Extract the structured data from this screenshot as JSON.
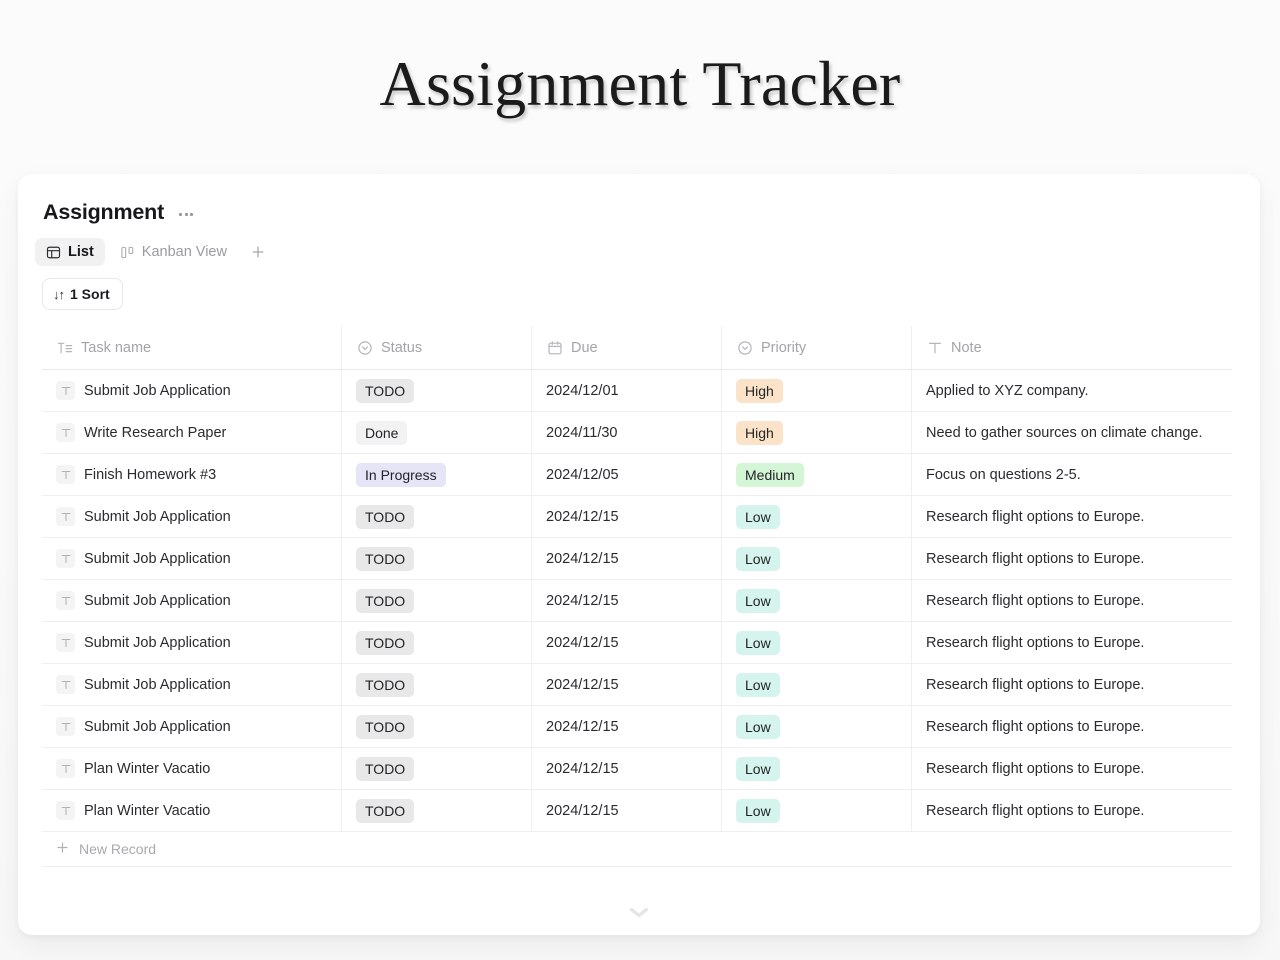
{
  "page": {
    "title": "Assignment Tracker"
  },
  "database": {
    "name": "Assignment",
    "more_menu_label": "···"
  },
  "views": {
    "tabs": [
      {
        "label": "List",
        "icon": "layout-list-icon",
        "active": true
      },
      {
        "label": "Kanban View",
        "icon": "kanban-columns-icon",
        "active": false
      }
    ],
    "add_view_label": "+"
  },
  "toolbar": {
    "sort": {
      "label": "1 Sort",
      "icon": "sort-arrows-icon",
      "glyph": "↓↑"
    }
  },
  "table": {
    "columns": [
      {
        "key": "task",
        "label": "Task name",
        "icon": "text-lines-icon"
      },
      {
        "key": "status",
        "label": "Status",
        "icon": "select-circle-icon"
      },
      {
        "key": "due",
        "label": "Due",
        "icon": "calendar-icon"
      },
      {
        "key": "priority",
        "label": "Priority",
        "icon": "select-circle-icon"
      },
      {
        "key": "note",
        "label": "Note",
        "icon": "text-t-icon"
      }
    ],
    "rows": [
      {
        "task": "Submit Job Application",
        "status": "TODO",
        "due": "2024/12/01",
        "priority": "High",
        "note": "Applied to XYZ company."
      },
      {
        "task": "Write Research Paper",
        "status": "Done",
        "due": "2024/11/30",
        "priority": "High",
        "note": "Need to gather sources on climate change."
      },
      {
        "task": "Finish Homework #3",
        "status": "In Progress",
        "due": "2024/12/05",
        "priority": "Medium",
        "note": "Focus on questions 2-5."
      },
      {
        "task": "Submit Job Application",
        "status": "TODO",
        "due": "2024/12/15",
        "priority": "Low",
        "note": "Research flight options to Europe."
      },
      {
        "task": "Submit Job Application",
        "status": "TODO",
        "due": "2024/12/15",
        "priority": "Low",
        "note": "Research flight options to Europe."
      },
      {
        "task": "Submit Job Application",
        "status": "TODO",
        "due": "2024/12/15",
        "priority": "Low",
        "note": "Research flight options to Europe."
      },
      {
        "task": "Submit Job Application",
        "status": "TODO",
        "due": "2024/12/15",
        "priority": "Low",
        "note": "Research flight options to Europe."
      },
      {
        "task": "Submit Job Application",
        "status": "TODO",
        "due": "2024/12/15",
        "priority": "Low",
        "note": "Research flight options to Europe."
      },
      {
        "task": "Submit Job Application",
        "status": "TODO",
        "due": "2024/12/15",
        "priority": "Low",
        "note": "Research flight options to Europe."
      },
      {
        "task": "Plan Winter Vacatio",
        "status": "TODO",
        "due": "2024/12/15",
        "priority": "Low",
        "note": "Research flight options to Europe."
      },
      {
        "task": "Plan Winter Vacatio",
        "status": "TODO",
        "due": "2024/12/15",
        "priority": "Low",
        "note": "Research flight options to Europe."
      }
    ],
    "new_record": {
      "label": "New Record",
      "icon": "plus-icon"
    }
  },
  "colors": {
    "status": {
      "TODO": {
        "bg": "#e8e8e9",
        "fg": "#232427"
      },
      "Done": {
        "bg": "#f2f2f3",
        "fg": "#232427"
      },
      "In Progress": {
        "bg": "#e6e4f7",
        "fg": "#232427"
      }
    },
    "priority": {
      "High": {
        "bg": "#fbe3c9",
        "fg": "#232427"
      },
      "Medium": {
        "bg": "#d4f5d6",
        "fg": "#232427"
      },
      "Low": {
        "bg": "#d5f4ee",
        "fg": "#232427"
      }
    },
    "card_bg": "#ffffff",
    "page_bg": "#fafafa",
    "accent_text": "#17181a"
  },
  "footer": {
    "collapse_icon": "chevron-down-icon"
  }
}
